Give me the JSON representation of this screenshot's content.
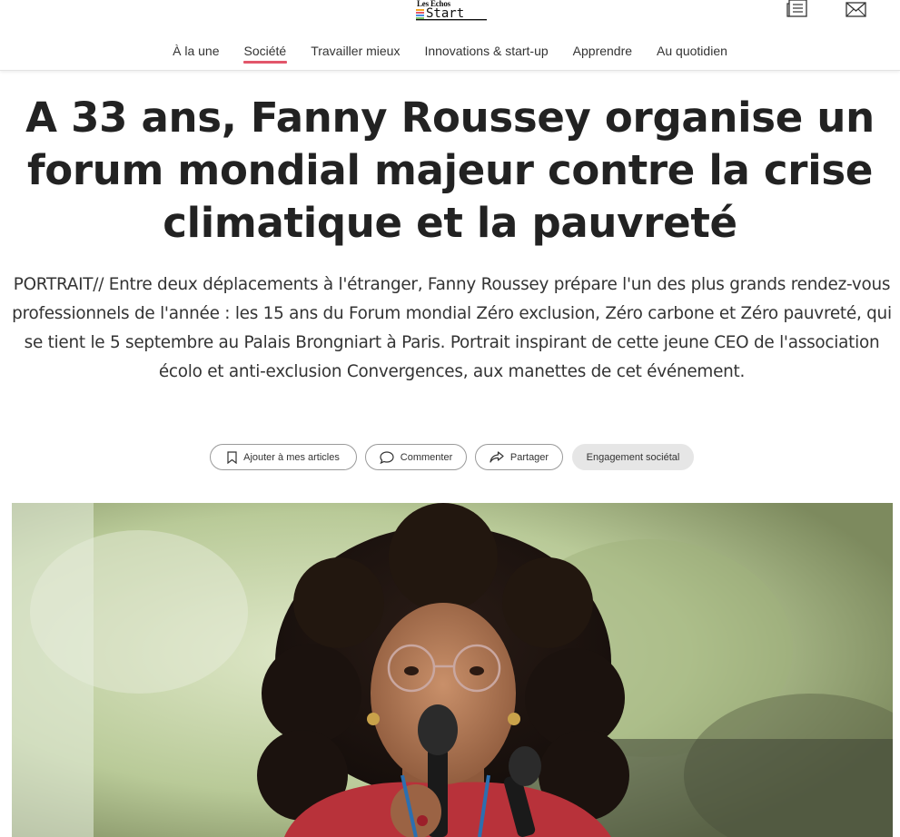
{
  "header": {
    "logo_top": "Les Echos",
    "logo_bottom": "Start",
    "brand_colors": [
      "#f5a623",
      "#e2566a",
      "#4a90e2"
    ],
    "icons": [
      "newspaper-icon",
      "envelope-icon"
    ]
  },
  "nav": {
    "items": [
      {
        "label": "À la une"
      },
      {
        "label": "Société"
      },
      {
        "label": "Travailler mieux"
      },
      {
        "label": "Innovations & start-up"
      },
      {
        "label": "Apprendre"
      },
      {
        "label": "Au quotidien"
      }
    ],
    "active_index": 1,
    "accent_color": "#e2566a"
  },
  "article": {
    "kicker": "PORTRAIT",
    "title": "A 33 ans, Fanny Roussey organise un forum mondial majeur contre la crise climatique et la pauvreté",
    "lede": "PORTRAIT// Entre deux déplacements à l'étranger, Fanny Roussey prépare l'un des plus grands rendez-vous professionnels de l'année : les 15 ans du Forum mondial Zéro exclusion, Zéro carbone et Zéro pauvreté, qui se tient le 5 septembre au Palais Brongniart à Paris. Portrait inspirant de cette jeune CEO de l'association écolo et anti-exclusion Convergences, aux manettes de cet événement."
  },
  "actions": {
    "bookmark_label": "Ajouter à mes articles",
    "comment_label": "Commenter",
    "share_label": "Partager",
    "tag_label": "Engagement sociétal"
  },
  "hero_image": {
    "subject": "woman with curly hair and glasses speaking into a microphone"
  }
}
